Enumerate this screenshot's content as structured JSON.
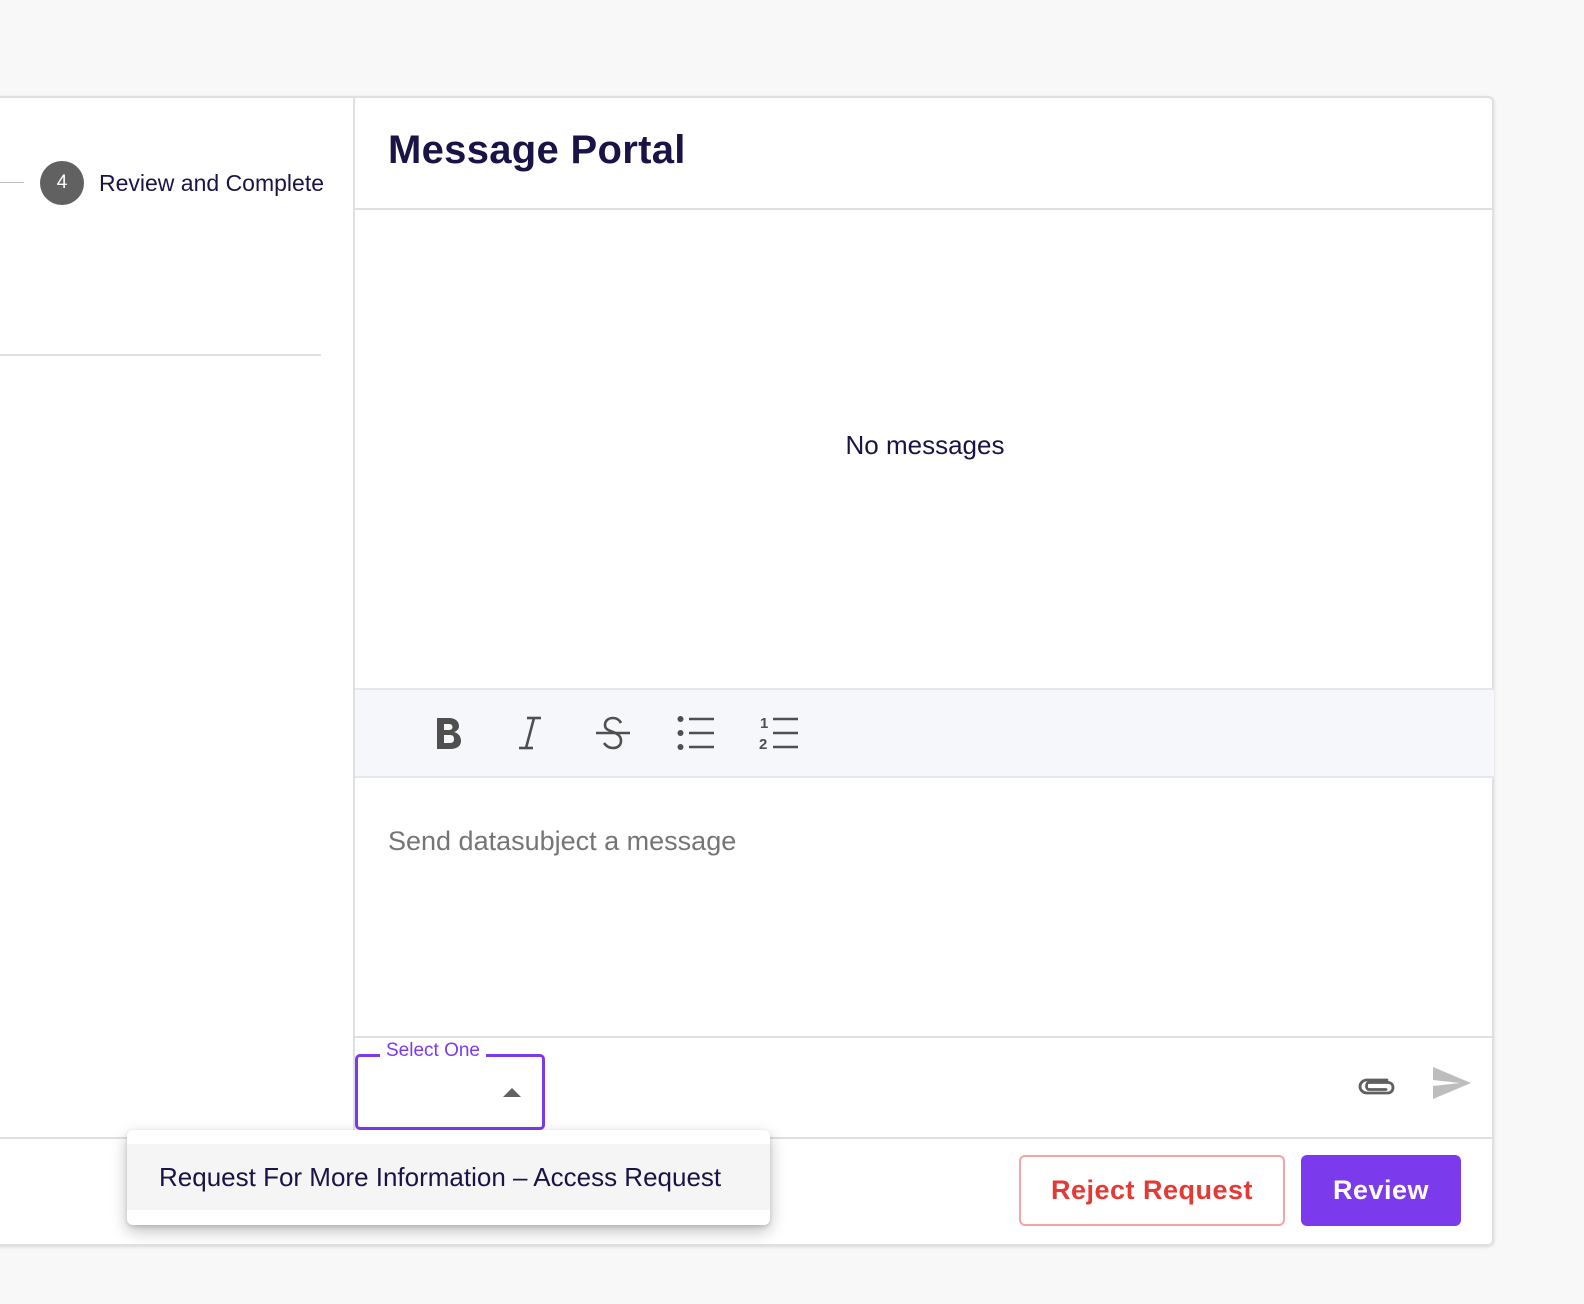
{
  "stepper": {
    "step_number": "4",
    "step_label": "Review and Complete"
  },
  "portal": {
    "title": "Message Portal",
    "empty_text": "No messages",
    "input_placeholder": "Send datasubject a message",
    "select_label": "Select One"
  },
  "toolbar": {
    "icons": [
      "bold-icon",
      "italic-icon",
      "strikethrough-icon",
      "bulleted-list-icon",
      "numbered-list-icon"
    ]
  },
  "dropdown": {
    "options": [
      "Request For More Information – Access Request"
    ]
  },
  "footer": {
    "reject_label": "Reject Request",
    "review_label": "Review"
  },
  "colors": {
    "accent": "#7c3aed",
    "danger": "#e53935",
    "text": "#1a1446"
  }
}
